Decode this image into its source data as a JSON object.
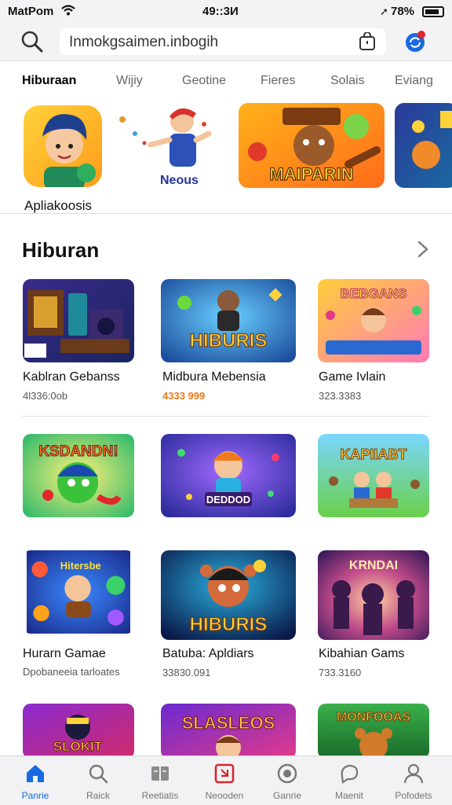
{
  "status_bar": {
    "carrier": "MatPom",
    "time": "49::3И",
    "battery": "78%"
  },
  "header": {
    "search_text": "Inmokgsaimen.inbogih"
  },
  "tabs": [
    "Hiburaan",
    "Wijiy",
    "Geotine",
    "Fieres",
    "Solais",
    "Eviang"
  ],
  "featured": {
    "app_label": "Apliakoosis",
    "mascot_label": "Neous",
    "banner_text": "MAIPARIN"
  },
  "section": {
    "title": "Hiburan",
    "items": [
      {
        "name": "Kablran Gebanss",
        "sub": "4l336:0ob",
        "art": ""
      },
      {
        "name": "Midbura Mebensia",
        "sub": "4333 999",
        "art": "HIBURIS"
      },
      {
        "name": "Game Ivlain",
        "sub": "323.3383",
        "art": "BEBGANS"
      },
      {
        "name": "",
        "sub": "",
        "art": "KSDANDN!"
      },
      {
        "name": "",
        "sub": "",
        "art": "DEDDOD"
      },
      {
        "name": "",
        "sub": "",
        "art": "KAPIIABT"
      },
      {
        "name": "Hurarn Gamae",
        "sub": "Dpobaneeia tarloates",
        "art": "Hitersbe"
      },
      {
        "name": "Batuba: Apldiars",
        "sub": "33830.091",
        "art": "HIBURIS"
      },
      {
        "name": "Kibahian Gams",
        "sub": "733.3160",
        "art": "KRNDAI"
      },
      {
        "name": "",
        "sub": "",
        "art": "SLOKIT"
      },
      {
        "name": "",
        "sub": "",
        "art": "SLASLEOS"
      },
      {
        "name": "",
        "sub": "",
        "art": "MONFOOAS"
      }
    ]
  },
  "nav": [
    {
      "label": "Panrie",
      "icon": "home-icon",
      "active": true
    },
    {
      "label": "Raick",
      "icon": "search-icon"
    },
    {
      "label": "Reetiatis",
      "icon": "book-icon"
    },
    {
      "label": "Neooden",
      "icon": "news-icon"
    },
    {
      "label": "Ganrie",
      "icon": "target-icon"
    },
    {
      "label": "Maenit",
      "icon": "chat-icon"
    },
    {
      "label": "Pofodets",
      "icon": "person-icon"
    }
  ],
  "colors": {
    "accent": "#1769e0",
    "price_orange": "#f07a1a",
    "badge_red": "#e0262e"
  }
}
